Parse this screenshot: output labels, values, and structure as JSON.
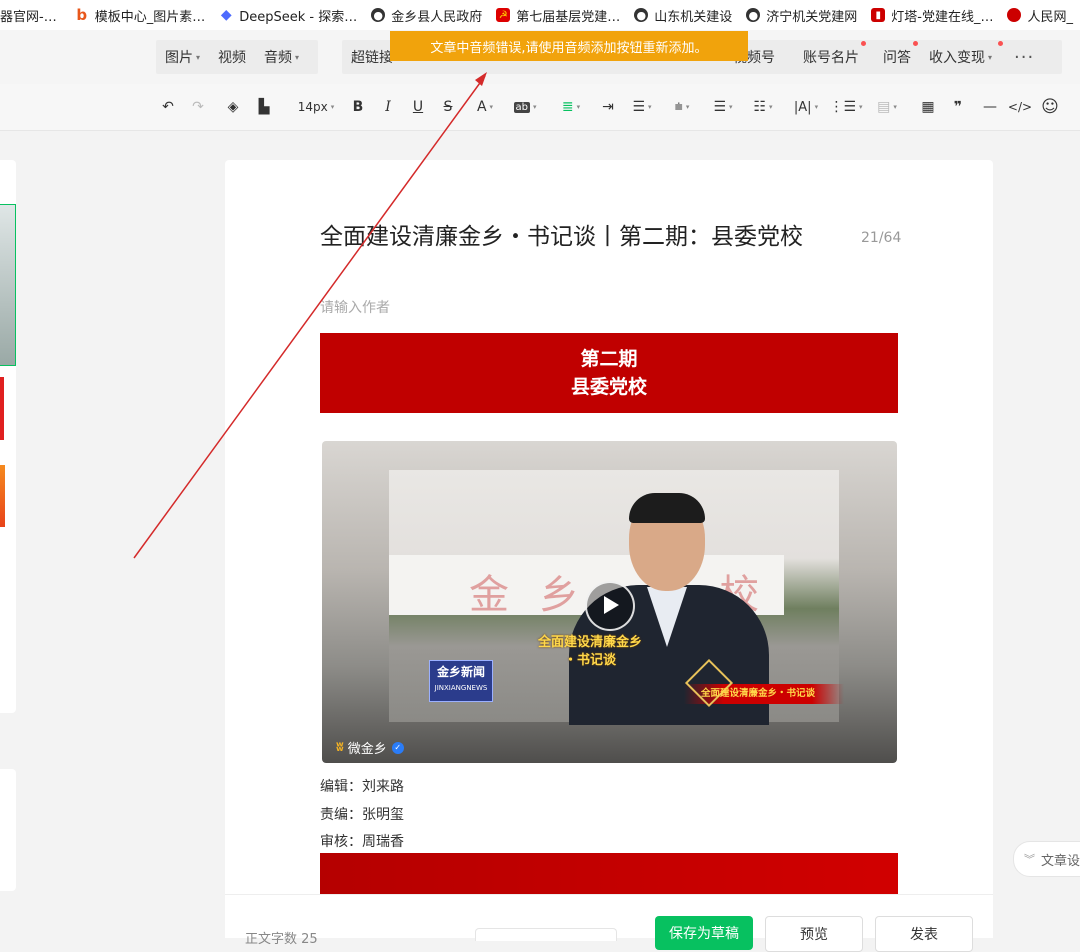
{
  "bookmarks": [
    {
      "label": "器官网-…",
      "icon": "page-icon"
    },
    {
      "label": "模板中心_图片素…",
      "icon": "bing-icon"
    },
    {
      "label": "DeepSeek - 探索…",
      "icon": "deepseek-icon"
    },
    {
      "label": "金乡县人民政府",
      "icon": "globe-icon"
    },
    {
      "label": "第七届基层党建…",
      "icon": "party-emblem-icon"
    },
    {
      "label": "山东机关建设",
      "icon": "globe-icon"
    },
    {
      "label": "济宁机关党建网",
      "icon": "globe-icon"
    },
    {
      "label": "灯塔-党建在线_…",
      "icon": "tower-icon"
    },
    {
      "label": "人民网_",
      "icon": "people-daily-icon"
    }
  ],
  "toast": "文章中音频错误,请使用音频添加按钮重新添加。",
  "tabs_group1": [
    {
      "label": "图片",
      "dropdown": true
    },
    {
      "label": "视频",
      "dropdown": false
    },
    {
      "label": "音频",
      "dropdown": true
    }
  ],
  "tabs_group2": [
    {
      "label": "超链接",
      "dropdown": false,
      "dot": false
    },
    {
      "label": "视频号",
      "dropdown": false,
      "dot": false
    },
    {
      "label": "账号名片",
      "dropdown": false,
      "dot": true
    },
    {
      "label": "问答",
      "dropdown": false,
      "dot": true
    },
    {
      "label": "收入变现",
      "dropdown": true,
      "dot": true
    },
    {
      "label": "···",
      "dropdown": false,
      "dot": false
    }
  ],
  "toolbar": {
    "font_size": "14px",
    "bold": "B",
    "italic": "I",
    "underline": "U",
    "strike": "S",
    "font_color": "A",
    "highlight": "ab",
    "letter_spacing": "|A|"
  },
  "editor": {
    "title": "全面建设清廉金乡・书记谈丨第二期：县委党校",
    "title_count": "21/64",
    "author_placeholder": "请输入作者",
    "banner_line1": "第二期",
    "banner_line2": "县委党校",
    "video": {
      "caption_line1": "全面建设清廉金乡",
      "caption_line2": "・书记谈",
      "news_logo_cn": "金乡新闻",
      "news_logo_en": "JINXIANGNEWS",
      "ribbon_text": "全面建设清廉金乡・书记谈",
      "wall_text_1": "金",
      "wall_text_2": "乡",
      "wall_text_3": "校",
      "channel": "微金乡"
    },
    "credits": [
      {
        "label": "编辑：刘来路"
      },
      {
        "label": "责编：张明玺"
      },
      {
        "label": "审核：周瑞香"
      }
    ]
  },
  "footer": {
    "word_count": "正文字数  25",
    "save_draft": "保存为草稿",
    "preview": "预览",
    "publish": "发表"
  },
  "side_pill": "文章设",
  "colors": {
    "accent_green": "#07c160",
    "warning": "#f1a30c",
    "banner_red": "#c00000",
    "arrow_red": "#d42a2a"
  }
}
